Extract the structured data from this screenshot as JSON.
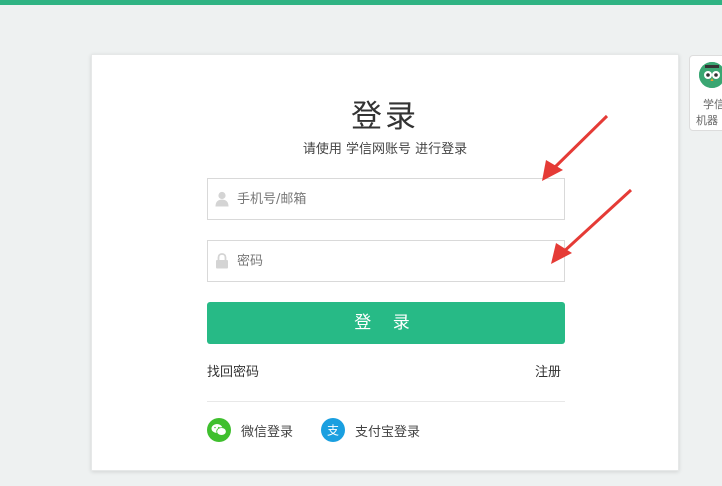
{
  "header": {
    "accent_color": "#2fb383"
  },
  "login": {
    "title": "登录",
    "subtitle": "请使用 学信网账号 进行登录",
    "phone_placeholder": "手机号/邮箱",
    "password_placeholder": "密码",
    "submit_label": "登 录",
    "forgot_label": "找回密码",
    "register_label": "注册",
    "wechat_label": "微信登录",
    "alipay_label": "支付宝登录",
    "button_color": "#27ba86"
  },
  "side_widget": {
    "line1": "学信",
    "line2": "机器"
  },
  "icons": {
    "user": "user-icon",
    "lock": "lock-icon",
    "wechat": "wechat-icon",
    "alipay": "alipay-icon"
  }
}
